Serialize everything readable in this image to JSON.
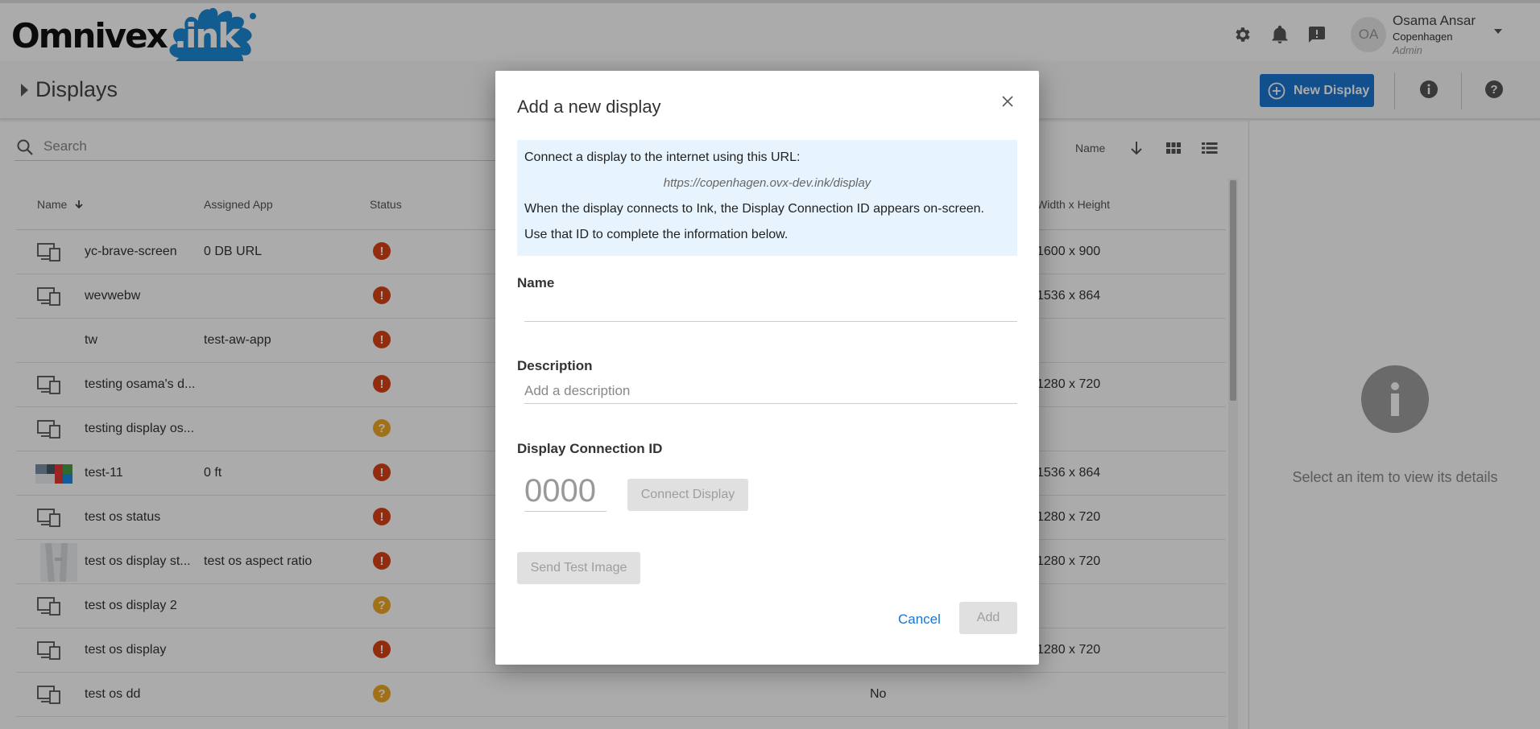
{
  "app": {
    "brand_name": "Omnivex.ink",
    "brand_part1": "Omnivex",
    "brand_part2": ".ink"
  },
  "header": {
    "user": {
      "initials": "OA",
      "name": "Osama Ansar",
      "location": "Copenhagen",
      "role": "Admin"
    },
    "icons": [
      "settings-icon",
      "notifications-icon",
      "feedback-icon"
    ]
  },
  "page": {
    "title": "Displays",
    "new_button_label": "New Display"
  },
  "search": {
    "placeholder": "Search",
    "value": ""
  },
  "sort": {
    "field": "Name"
  },
  "table": {
    "columns": {
      "name": "Name",
      "assigned_app": "Assigned App",
      "status": "Status",
      "size": "Width x Height"
    },
    "rows": [
      {
        "name": "yc-brave-screen",
        "app": "0 DB URL",
        "status": "error",
        "extra": "",
        "size": "1600 x 900",
        "thumb": "device"
      },
      {
        "name": "wevwebw",
        "app": "",
        "status": "error",
        "extra": "",
        "size": "1536 x 864",
        "thumb": "device"
      },
      {
        "name": "tw",
        "app": "test-aw-app",
        "status": "error",
        "extra": "",
        "size": "",
        "thumb": "none"
      },
      {
        "name": "testing osama's d...",
        "app": "",
        "status": "error",
        "extra": "",
        "size": "1280 x 720",
        "thumb": "device"
      },
      {
        "name": "testing display os...",
        "app": "",
        "status": "unknown",
        "extra": "",
        "size": "",
        "thumb": "device"
      },
      {
        "name": "test-11",
        "app": "0 ft",
        "status": "error",
        "extra": "",
        "size": "1536 x 864",
        "thumb": "image"
      },
      {
        "name": "test os status",
        "app": "",
        "status": "error",
        "extra": "",
        "size": "1280 x 720",
        "thumb": "device"
      },
      {
        "name": "test os display st...",
        "app": "test os aspect ratio",
        "status": "error",
        "extra": "",
        "size": "1280 x 720",
        "thumb": "photo"
      },
      {
        "name": "test os display 2",
        "app": "",
        "status": "unknown",
        "extra": "",
        "size": "",
        "thumb": "device"
      },
      {
        "name": "test os display",
        "app": "",
        "status": "error",
        "extra": "",
        "size": "1280 x 720",
        "thumb": "device"
      },
      {
        "name": "test os dd",
        "app": "",
        "status": "unknown",
        "extra": "No",
        "size": "",
        "thumb": "device"
      }
    ],
    "status_glyphs": {
      "error": "!",
      "unknown": "?"
    }
  },
  "details_panel": {
    "empty_text": "Select an item to view its details"
  },
  "modal": {
    "title": "Add a new display",
    "info_intro": "Connect a display to the internet using this URL:",
    "info_url": "https://copenhagen.ovx-dev.ink/display",
    "info_instructions": "When the display connects to Ink, the Display Connection ID appears on-screen. Use that ID to complete the information below.",
    "name_label": "Name",
    "name_value": "",
    "description_label": "Description",
    "description_placeholder": "Add a description",
    "connection_label": "Display Connection ID",
    "connection_placeholder": "0000",
    "connect_button": "Connect Display",
    "test_button": "Send Test Image",
    "cancel_button": "Cancel",
    "add_button": "Add"
  },
  "colors": {
    "accent": "#1a76d2",
    "logo_splat": "#1b8ad6",
    "status_error": "#d84315",
    "status_unknown": "#f0a928",
    "info_box": "#e8f4fd"
  }
}
